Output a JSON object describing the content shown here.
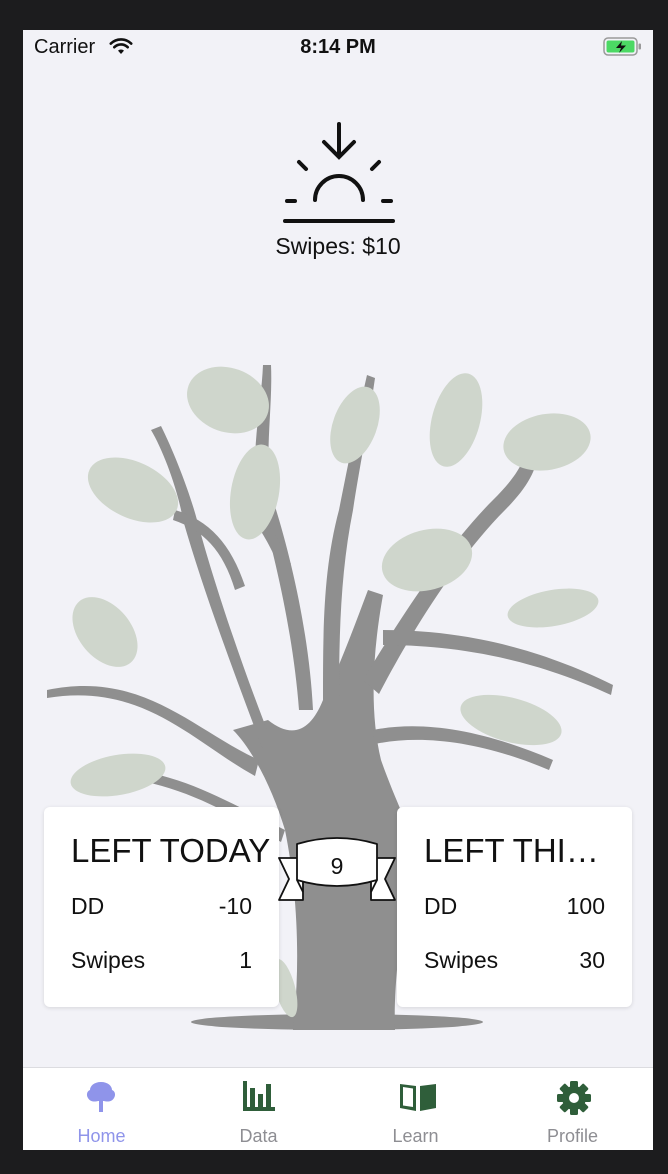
{
  "status_bar": {
    "carrier": "Carrier",
    "time": "8:14 PM"
  },
  "header": {
    "icon": "sunset-icon",
    "swipes_label": "Swipes: $10"
  },
  "banner": {
    "value": "9"
  },
  "left_card": {
    "title": "LEFT TODAY",
    "rows": [
      {
        "label": "DD",
        "value": "-10"
      },
      {
        "label": "Swipes",
        "value": "1"
      }
    ]
  },
  "right_card": {
    "title": "LEFT THIS...",
    "rows": [
      {
        "label": "DD",
        "value": "100"
      },
      {
        "label": "Swipes",
        "value": "30"
      }
    ]
  },
  "tab_bar": {
    "tabs": [
      {
        "label": "Home",
        "icon": "tree-icon",
        "active": true
      },
      {
        "label": "Data",
        "icon": "bar-chart-icon",
        "active": false
      },
      {
        "label": "Learn",
        "icon": "book-icon",
        "active": false
      },
      {
        "label": "Profile",
        "icon": "gear-icon",
        "active": false
      }
    ]
  },
  "colors": {
    "active_tab": "#8f94ea",
    "inactive_icon": "#2f5e3a",
    "inactive_label": "#8e8e93",
    "tree": "#8f8f8f",
    "leaf": "#cfd6cc",
    "battery": "#4cd964"
  }
}
